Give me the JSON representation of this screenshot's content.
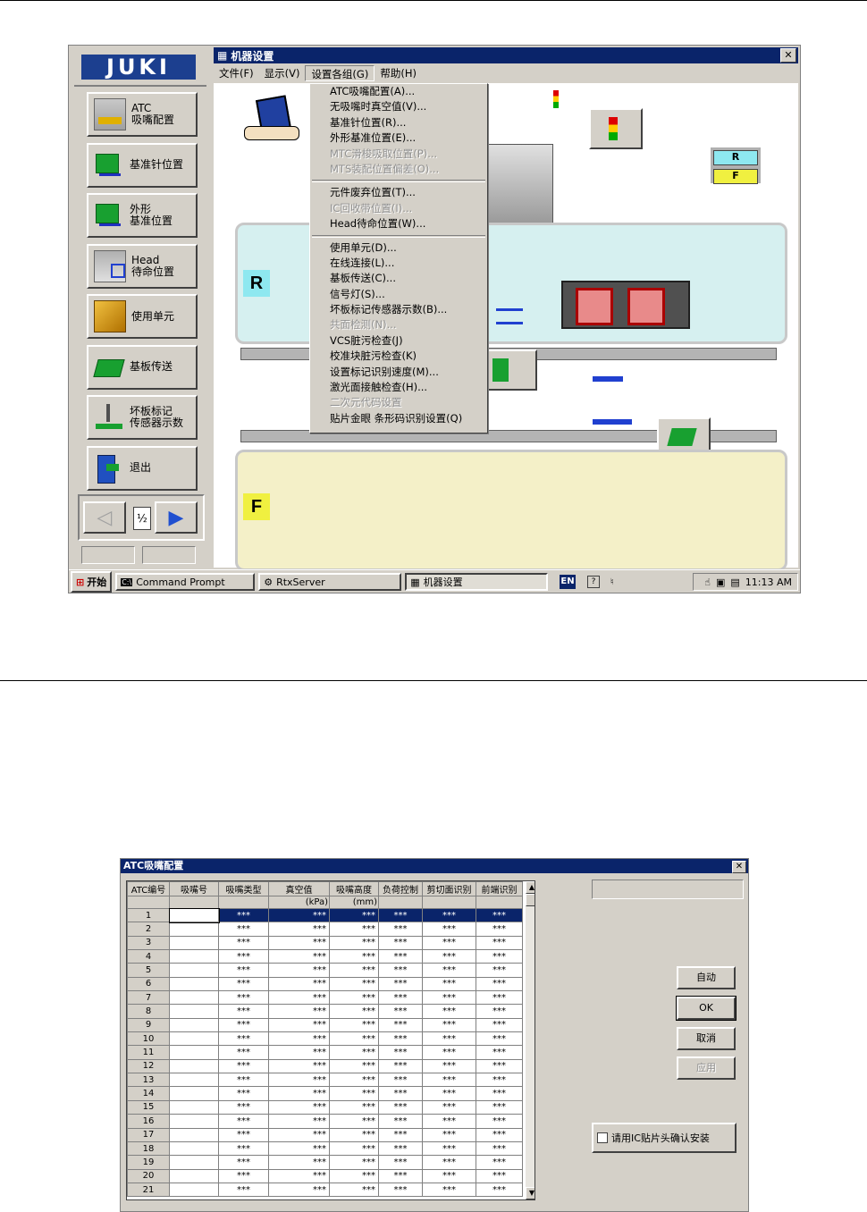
{
  "screen1": {
    "logo": "JUKI",
    "side_buttons": [
      {
        "label": "ATC\n吸嘴配置",
        "icon": "atc-nozzle-icon"
      },
      {
        "label": "基准针位置",
        "icon": "reference-pin-icon"
      },
      {
        "label": "外形\n基准位置",
        "icon": "outline-reference-icon"
      },
      {
        "label": "Head\n待命位置",
        "icon": "head-standby-icon"
      },
      {
        "label": "使用单元",
        "icon": "unit-icon"
      },
      {
        "label": "基板传送",
        "icon": "board-transfer-icon"
      },
      {
        "label": "坏板标记\n传感器示数",
        "icon": "bad-mark-sensor-icon"
      },
      {
        "label": "退出",
        "icon": "exit-icon"
      }
    ],
    "page_indicator": "½",
    "window_title": "机器设置",
    "menu": [
      "文件(F)",
      "显示(V)",
      "设置各组(G)",
      "帮助(H)"
    ],
    "dropdown": [
      {
        "label": "ATC吸嘴配置(A)...",
        "enabled": true
      },
      {
        "label": "无吸嘴时真空值(V)...",
        "enabled": true
      },
      {
        "label": "基准针位置(R)...",
        "enabled": true
      },
      {
        "label": "外形基准位置(E)...",
        "enabled": true
      },
      {
        "label": "MTC滑梭吸取位置(P)...",
        "enabled": false
      },
      {
        "label": "MTS装配位置偏差(O)...",
        "enabled": false
      },
      {
        "sep": true
      },
      {
        "label": "元件废弃位置(T)...",
        "enabled": true
      },
      {
        "label": "IC回收带位置(I)...",
        "enabled": false
      },
      {
        "label": "Head待命位置(W)...",
        "enabled": true
      },
      {
        "sep": true
      },
      {
        "label": "使用单元(D)...",
        "enabled": true
      },
      {
        "label": "在线连接(L)...",
        "enabled": true
      },
      {
        "label": "基板传送(C)...",
        "enabled": true
      },
      {
        "label": "信号灯(S)...",
        "enabled": true
      },
      {
        "label": "坏板标记传感器示数(B)...",
        "enabled": true
      },
      {
        "label": "共面检测(N)...",
        "enabled": false
      },
      {
        "label": "VCS脏污检查(J)",
        "enabled": true
      },
      {
        "label": "校准块脏污检查(K)",
        "enabled": true
      },
      {
        "label": "设置标记识别速度(M)...",
        "enabled": true
      },
      {
        "label": "激光面接触检查(H)...",
        "enabled": true
      },
      {
        "label": "二次元代码设置",
        "enabled": false
      },
      {
        "label": "贴片金眼 条形码识别设置(Q)",
        "enabled": true
      }
    ],
    "zone_r": "R",
    "zone_f": "F",
    "legend": {
      "r": "R",
      "f": "F",
      "r_color": "#8ee8f0",
      "f_color": "#f0f040"
    },
    "taskbar": {
      "start": "开始",
      "tasks": [
        "Command Prompt",
        "RtxServer",
        "机器设置"
      ],
      "lang": "EN",
      "clock": "11:13 AM"
    }
  },
  "screen2": {
    "title": "ATC吸嘴配置",
    "columns": [
      "ATC编号",
      "吸嘴号",
      "吸嘴类型",
      "真空值",
      "吸嘴高度",
      "负荷控制",
      "剪切面识别",
      "前端识别"
    ],
    "units": [
      "",
      "",
      "",
      "(kPa)",
      "(mm)",
      "",
      "",
      ""
    ],
    "rows": [
      "1",
      "2",
      "3",
      "4",
      "5",
      "6",
      "7",
      "8",
      "9",
      "10",
      "11",
      "12",
      "13",
      "14",
      "15",
      "16",
      "17",
      "18",
      "19",
      "20",
      "21"
    ],
    "cell_value": "***",
    "buttons": {
      "auto": "自动",
      "ok": "OK",
      "cancel": "取消",
      "apply": "应用"
    },
    "checkbox_label": "请用IC贴片头确认安装"
  }
}
